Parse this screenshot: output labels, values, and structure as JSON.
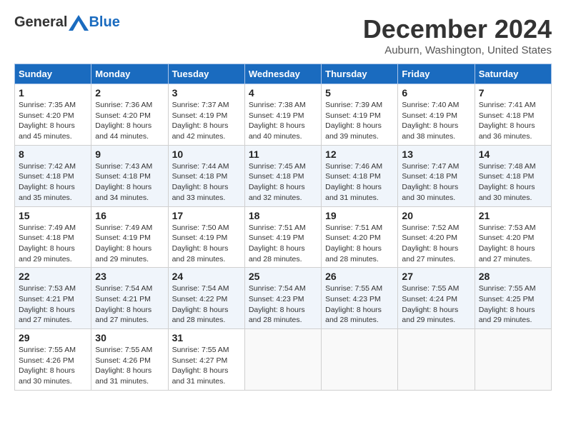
{
  "header": {
    "logo_general": "General",
    "logo_blue": "Blue",
    "month_title": "December 2024",
    "location": "Auburn, Washington, United States"
  },
  "days_of_week": [
    "Sunday",
    "Monday",
    "Tuesday",
    "Wednesday",
    "Thursday",
    "Friday",
    "Saturday"
  ],
  "weeks": [
    [
      {
        "day": "1",
        "sunrise": "7:35 AM",
        "sunset": "4:20 PM",
        "daylight": "8 hours and 45 minutes."
      },
      {
        "day": "2",
        "sunrise": "7:36 AM",
        "sunset": "4:20 PM",
        "daylight": "8 hours and 44 minutes."
      },
      {
        "day": "3",
        "sunrise": "7:37 AM",
        "sunset": "4:19 PM",
        "daylight": "8 hours and 42 minutes."
      },
      {
        "day": "4",
        "sunrise": "7:38 AM",
        "sunset": "4:19 PM",
        "daylight": "8 hours and 40 minutes."
      },
      {
        "day": "5",
        "sunrise": "7:39 AM",
        "sunset": "4:19 PM",
        "daylight": "8 hours and 39 minutes."
      },
      {
        "day": "6",
        "sunrise": "7:40 AM",
        "sunset": "4:19 PM",
        "daylight": "8 hours and 38 minutes."
      },
      {
        "day": "7",
        "sunrise": "7:41 AM",
        "sunset": "4:18 PM",
        "daylight": "8 hours and 36 minutes."
      }
    ],
    [
      {
        "day": "8",
        "sunrise": "7:42 AM",
        "sunset": "4:18 PM",
        "daylight": "8 hours and 35 minutes."
      },
      {
        "day": "9",
        "sunrise": "7:43 AM",
        "sunset": "4:18 PM",
        "daylight": "8 hours and 34 minutes."
      },
      {
        "day": "10",
        "sunrise": "7:44 AM",
        "sunset": "4:18 PM",
        "daylight": "8 hours and 33 minutes."
      },
      {
        "day": "11",
        "sunrise": "7:45 AM",
        "sunset": "4:18 PM",
        "daylight": "8 hours and 32 minutes."
      },
      {
        "day": "12",
        "sunrise": "7:46 AM",
        "sunset": "4:18 PM",
        "daylight": "8 hours and 31 minutes."
      },
      {
        "day": "13",
        "sunrise": "7:47 AM",
        "sunset": "4:18 PM",
        "daylight": "8 hours and 30 minutes."
      },
      {
        "day": "14",
        "sunrise": "7:48 AM",
        "sunset": "4:18 PM",
        "daylight": "8 hours and 30 minutes."
      }
    ],
    [
      {
        "day": "15",
        "sunrise": "7:49 AM",
        "sunset": "4:18 PM",
        "daylight": "8 hours and 29 minutes."
      },
      {
        "day": "16",
        "sunrise": "7:49 AM",
        "sunset": "4:19 PM",
        "daylight": "8 hours and 29 minutes."
      },
      {
        "day": "17",
        "sunrise": "7:50 AM",
        "sunset": "4:19 PM",
        "daylight": "8 hours and 28 minutes."
      },
      {
        "day": "18",
        "sunrise": "7:51 AM",
        "sunset": "4:19 PM",
        "daylight": "8 hours and 28 minutes."
      },
      {
        "day": "19",
        "sunrise": "7:51 AM",
        "sunset": "4:20 PM",
        "daylight": "8 hours and 28 minutes."
      },
      {
        "day": "20",
        "sunrise": "7:52 AM",
        "sunset": "4:20 PM",
        "daylight": "8 hours and 27 minutes."
      },
      {
        "day": "21",
        "sunrise": "7:53 AM",
        "sunset": "4:20 PM",
        "daylight": "8 hours and 27 minutes."
      }
    ],
    [
      {
        "day": "22",
        "sunrise": "7:53 AM",
        "sunset": "4:21 PM",
        "daylight": "8 hours and 27 minutes."
      },
      {
        "day": "23",
        "sunrise": "7:54 AM",
        "sunset": "4:21 PM",
        "daylight": "8 hours and 27 minutes."
      },
      {
        "day": "24",
        "sunrise": "7:54 AM",
        "sunset": "4:22 PM",
        "daylight": "8 hours and 28 minutes."
      },
      {
        "day": "25",
        "sunrise": "7:54 AM",
        "sunset": "4:23 PM",
        "daylight": "8 hours and 28 minutes."
      },
      {
        "day": "26",
        "sunrise": "7:55 AM",
        "sunset": "4:23 PM",
        "daylight": "8 hours and 28 minutes."
      },
      {
        "day": "27",
        "sunrise": "7:55 AM",
        "sunset": "4:24 PM",
        "daylight": "8 hours and 29 minutes."
      },
      {
        "day": "28",
        "sunrise": "7:55 AM",
        "sunset": "4:25 PM",
        "daylight": "8 hours and 29 minutes."
      }
    ],
    [
      {
        "day": "29",
        "sunrise": "7:55 AM",
        "sunset": "4:26 PM",
        "daylight": "8 hours and 30 minutes."
      },
      {
        "day": "30",
        "sunrise": "7:55 AM",
        "sunset": "4:26 PM",
        "daylight": "8 hours and 31 minutes."
      },
      {
        "day": "31",
        "sunrise": "7:55 AM",
        "sunset": "4:27 PM",
        "daylight": "8 hours and 31 minutes."
      },
      null,
      null,
      null,
      null
    ]
  ]
}
